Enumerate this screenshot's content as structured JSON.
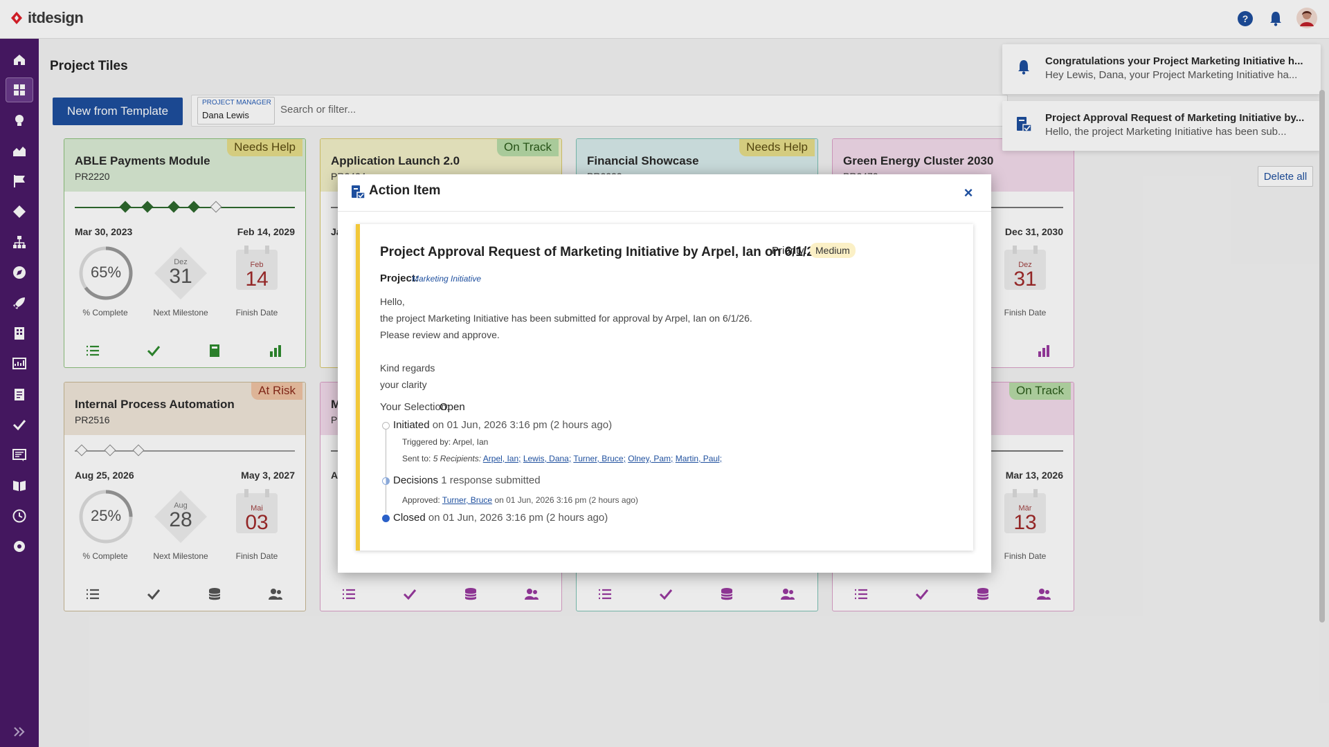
{
  "app": {
    "name": "itdesign",
    "brand_color": "#e0202a",
    "sidebar_color": "#4a1a68",
    "primary_color": "#1e4f9e"
  },
  "topbar": {
    "icons": [
      "help-icon",
      "bell-icon",
      "avatar"
    ]
  },
  "sidebar": {
    "items": [
      "home-icon",
      "tiles-icon",
      "bulb-icon",
      "chart-area-icon",
      "flag-icon",
      "diamond-icon",
      "hierarchy-icon",
      "compass-icon",
      "rocket-icon",
      "building-icon",
      "dashboard-icon",
      "clipboard-icon",
      "check-icon",
      "list-icon",
      "book-icon",
      "clock-icon",
      "settings-icon"
    ],
    "expand_icon": "double-chevron-right-icon"
  },
  "page": {
    "title": "Project Tiles"
  },
  "toolbar": {
    "new_label": "New from Template",
    "pm_label": "Project Manager",
    "pm_value": "Dana Lewis",
    "search_placeholder": "Search or filter..."
  },
  "tiles": [
    {
      "title": "ABLE Payments Module",
      "code": "PR2220",
      "badge": "Needs Help",
      "start": "Mar 30, 2023",
      "end": "Feb 14, 2029",
      "complete": "65%",
      "complete_lbl": "% Complete",
      "ms_month": "Dez",
      "ms_day": "31",
      "ms_lbl": "Next Milestone",
      "fin_month": "Feb",
      "fin_day": "14",
      "fin_lbl": "Finish Date",
      "progress": 0.65
    },
    {
      "title": "Application Launch 2.0",
      "code": "PR2424",
      "badge": "On Track",
      "start": "Ja"
    },
    {
      "title": "Financial Showcase",
      "code": "PR2232",
      "badge": "Needs Help"
    },
    {
      "title": "Green Energy Cluster 2030",
      "code": "PR2472",
      "end": "Dec 31, 2030",
      "fin_month": "Dez",
      "fin_day": "31",
      "fin_lbl": "Finish Date"
    },
    {
      "title": "Internal Process Automation",
      "code": "PR2516",
      "badge": "At Risk",
      "start": "Aug 25, 2026",
      "end": "May 3, 2027",
      "complete": "25%",
      "complete_lbl": "% Complete",
      "ms_month": "Aug",
      "ms_day": "28",
      "ms_lbl": "Next Milestone",
      "fin_month": "Mai",
      "fin_day": "03",
      "fin_lbl": "Finish Date",
      "progress": 0.25
    },
    {
      "title": "M",
      "code": "P",
      "start": "A"
    },
    {},
    {
      "title": "ies",
      "badge": "On Track",
      "end": "Mar 13, 2026",
      "fin_month": "Mär",
      "fin_day": "13",
      "fin_lbl": "Finish Date"
    }
  ],
  "notifications": [
    {
      "title": "Congratulations your Project Marketing Initiative h...",
      "body": "Hey Lewis, Dana, your Project Marketing Initiative ha..."
    },
    {
      "title": "Project Approval Request of Marketing Initiative by...",
      "body": "Hello, the project Marketing Initiative has been sub..."
    }
  ],
  "delete_all_label": "Delete all",
  "modal": {
    "title": "Action Item",
    "close": "×",
    "item_title": "Project Approval Request of Marketing Initiative by Arpel, Ian on 6/1/26",
    "priority_label": "Priority:",
    "priority_value": "Medium",
    "project_label": "Project:",
    "project_value": "Marketing Initiative",
    "body": [
      "Hello,",
      "the project Marketing Initiative has been submitted for approval by Arpel, Ian on 6/1/26.",
      "Please review and approve.",
      "Kind regards",
      "your clarity"
    ],
    "selection_label": "Your Selection:",
    "selection_value": "Open",
    "timeline": {
      "initiated": "Initiated",
      "initiated_when": "on 01 Jun, 2026 3:16 pm (2 hours ago)",
      "triggered_by_lbl": "Triggered by:",
      "triggered_by": "Arpel, Ian",
      "sent_to_lbl": "Sent to:",
      "sent_to_count": "5 Recipients:",
      "recipients": [
        "Arpel, Ian;",
        "Lewis, Dana;",
        "Turner, Bruce;",
        "Olney, Pam;",
        "Martin, Paul;"
      ],
      "decisions": "Decisions",
      "decisions_info": "1 response submitted",
      "approved_lbl": "Approved:",
      "approved_by": "Turner, Bruce",
      "approved_when": "on 01 Jun, 2026 3:16 pm (2 hours ago)",
      "closed": "Closed",
      "closed_when": "on 01 Jun, 2026 3:16 pm (2 hours ago)"
    }
  }
}
